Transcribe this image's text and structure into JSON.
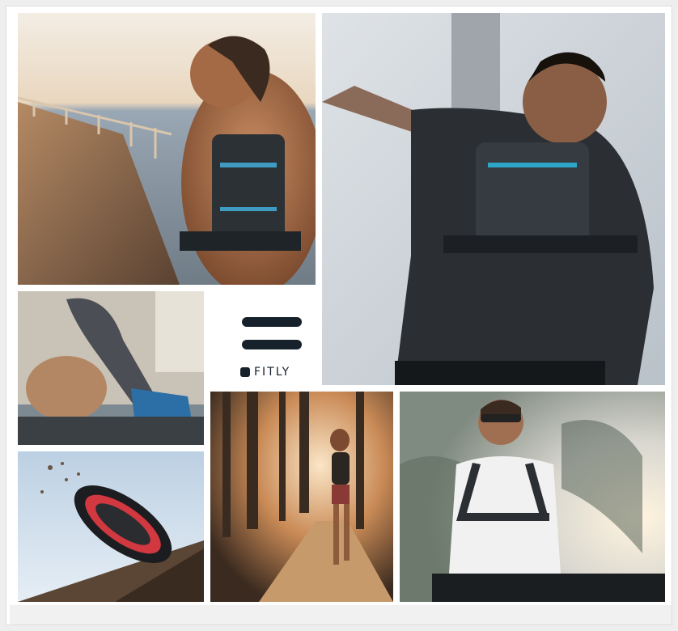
{
  "brand": {
    "name": "FITLY",
    "logo_color": "#16212b"
  },
  "photos": [
    {
      "id": "woman-seaside-vest",
      "description_icon": "runner-back-photo"
    },
    {
      "id": "man-black-shirt-vest",
      "description_icon": "runner-back-photo"
    },
    {
      "id": "tying-shoe",
      "description_icon": "shoe-lacing-photo"
    },
    {
      "id": "shoe-sole-dirt",
      "description_icon": "shoe-sole-photo"
    },
    {
      "id": "forest-runner",
      "description_icon": "forest-run-photo"
    },
    {
      "id": "man-sunglasses-harness",
      "description_icon": "portrait-photo"
    }
  ]
}
